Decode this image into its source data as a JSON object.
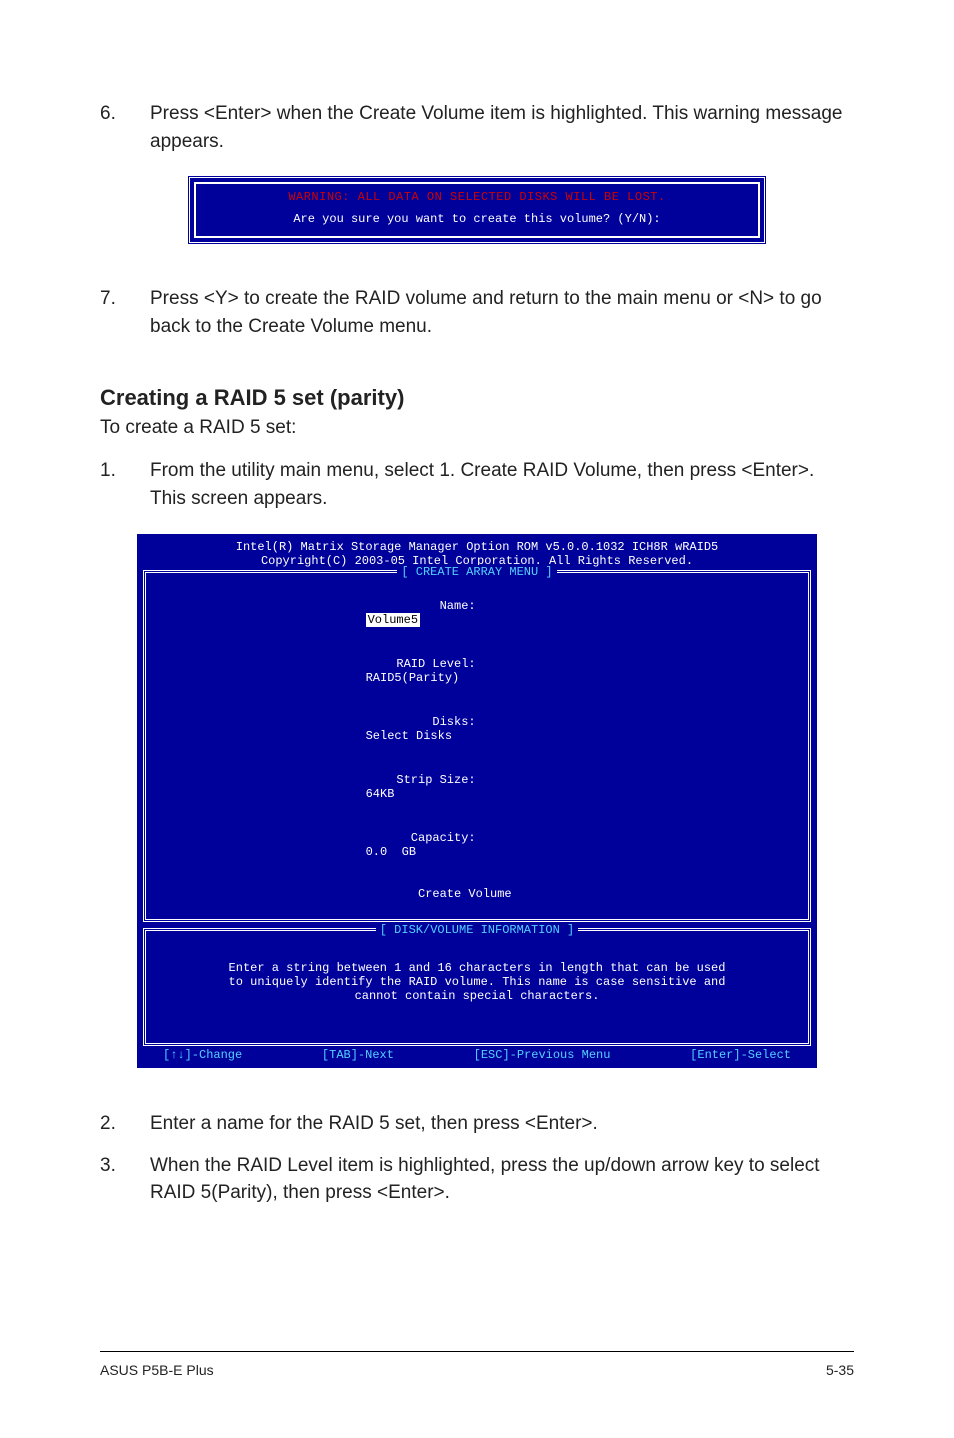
{
  "steps": {
    "s6_num": "6.",
    "s6_text": "Press <Enter> when the Create Volume item is highlighted. This warning message appears.",
    "s7_num": "7.",
    "s7_text": "Press <Y> to create the RAID volume and return to the main menu or <N> to go back to the Create Volume menu.",
    "s1_num": "1.",
    "s1_text": "From the utility main menu, select 1. Create RAID Volume, then press <Enter>. This screen appears.",
    "s2_num": "2.",
    "s2_text": "Enter a name for the RAID 5 set, then press <Enter>.",
    "s3_num": "3.",
    "s3_text": "When the RAID Level item is highlighted, press the up/down arrow key to select RAID 5(Parity), then press <Enter>."
  },
  "warn": {
    "line": "WARNING: ALL DATA ON SELECTED DISKS WILL BE LOST.",
    "prompt": "Are you sure you want to create this volume? (Y/N):"
  },
  "section": {
    "heading": "Creating a RAID 5 set (parity)",
    "sub": "To create a RAID 5 set:"
  },
  "bios": {
    "title1": "Intel(R) Matrix Storage Manager Option ROM v5.0.0.1032 ICH8R wRAID5",
    "title2": "Copyright(C) 2003-05 Intel Corporation. All Rights Reserved.",
    "panel1_label": "[ CREATE ARRAY MENU ]",
    "panel2_label": "[ DISK/VOLUME INFORMATION ]",
    "fields": {
      "name_l": "Name:",
      "name_v": "Volume5",
      "raid_l": "RAID Level:",
      "raid_v": "RAID5(Parity)",
      "disks_l": "Disks:",
      "disks_v": "Select Disks",
      "strip_l": "Strip Size:",
      "strip_v": "64KB",
      "cap_l": "Capacity:",
      "cap_v": "0.0  GB",
      "create": "Create Volume"
    },
    "info1": "Enter a string between 1 and 16 characters in length that can be used",
    "info2": "to uniquely identify the RAID volume. This name is case sensitive and",
    "info3": "cannot contain special characters.",
    "status": {
      "change": "[↑↓]-Change",
      "tab": "[TAB]-Next",
      "esc": "[ESC]-Previous Menu",
      "enter": "[Enter]-Select"
    }
  },
  "footer": {
    "left": "ASUS P5B-E Plus",
    "right": "5-35"
  }
}
